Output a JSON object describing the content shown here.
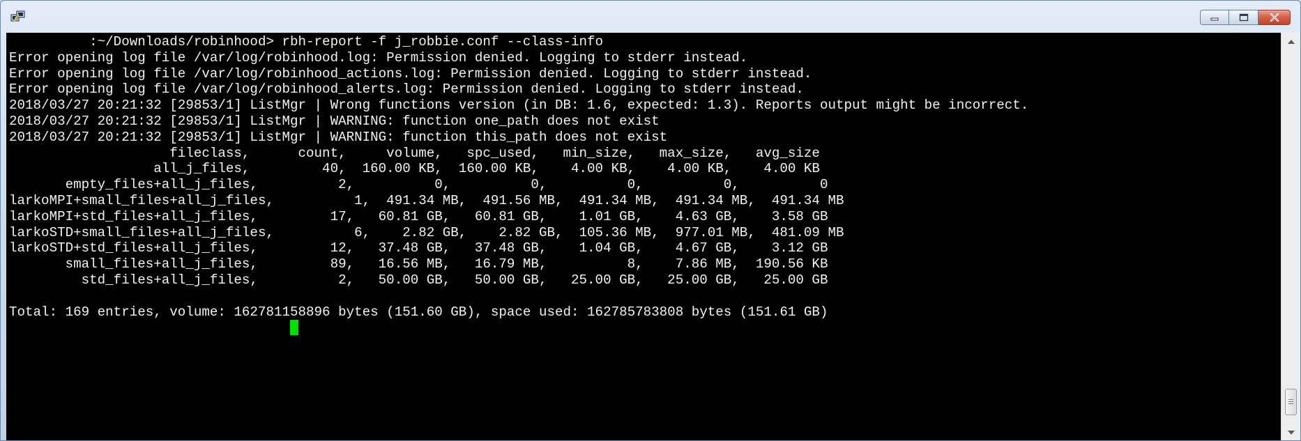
{
  "window": {
    "icon": "putty-icon",
    "controls": [
      "minimize-icon",
      "maximize-icon",
      "close-icon"
    ],
    "accent_close": "#c9462f"
  },
  "terminal": {
    "background": "#000000",
    "foreground": "#f2f2f2",
    "cursor_color": "#00e000",
    "lines": [
      "          :~/Downloads/robinhood> rbh-report -f j_robbie.conf --class-info",
      "Error opening log file /var/log/robinhood.log: Permission denied. Logging to stderr instead.",
      "Error opening log file /var/log/robinhood_actions.log: Permission denied. Logging to stderr instead.",
      "Error opening log file /var/log/robinhood_alerts.log: Permission denied. Logging to stderr instead.",
      "2018/03/27 20:21:32 [29853/1] ListMgr | Wrong functions version (in DB: 1.6, expected: 1.3). Reports output might be incorrect.",
      "2018/03/27 20:21:32 [29853/1] ListMgr | WARNING: function one_path does not exist",
      "2018/03/27 20:21:32 [29853/1] ListMgr | WARNING: function this_path does not exist",
      "                    fileclass,      count,     volume,   spc_used,   min_size,   max_size,   avg_size",
      "                  all_j_files,         40,  160.00 KB,  160.00 KB,    4.00 KB,    4.00 KB,    4.00 KB",
      "       empty_files+all_j_files,          2,          0,          0,          0,          0,          0",
      "larkoMPI+small_files+all_j_files,          1,  491.34 MB,  491.56 MB,  491.34 MB,  491.34 MB,  491.34 MB",
      "larkoMPI+std_files+all_j_files,         17,   60.81 GB,   60.81 GB,    1.01 GB,    4.63 GB,    3.58 GB",
      "larkoSTD+small_files+all_j_files,          6,    2.82 GB,    2.82 GB,  105.36 MB,  977.01 MB,  481.09 MB",
      "larkoSTD+std_files+all_j_files,         12,   37.48 GB,   37.48 GB,    1.04 GB,    4.67 GB,    3.12 GB",
      "       small_files+all_j_files,         89,   16.56 MB,   16.79 MB,          8,    7.86 MB,  190.56 KB",
      "         std_files+all_j_files,          2,   50.00 GB,   50.00 GB,   25.00 GB,   25.00 GB,   25.00 GB",
      "",
      "Total: 169 entries, volume: 162781158896 bytes (151.60 GB), space used: 162785783808 bytes (151.61 GB)",
      "                                   "
    ]
  }
}
